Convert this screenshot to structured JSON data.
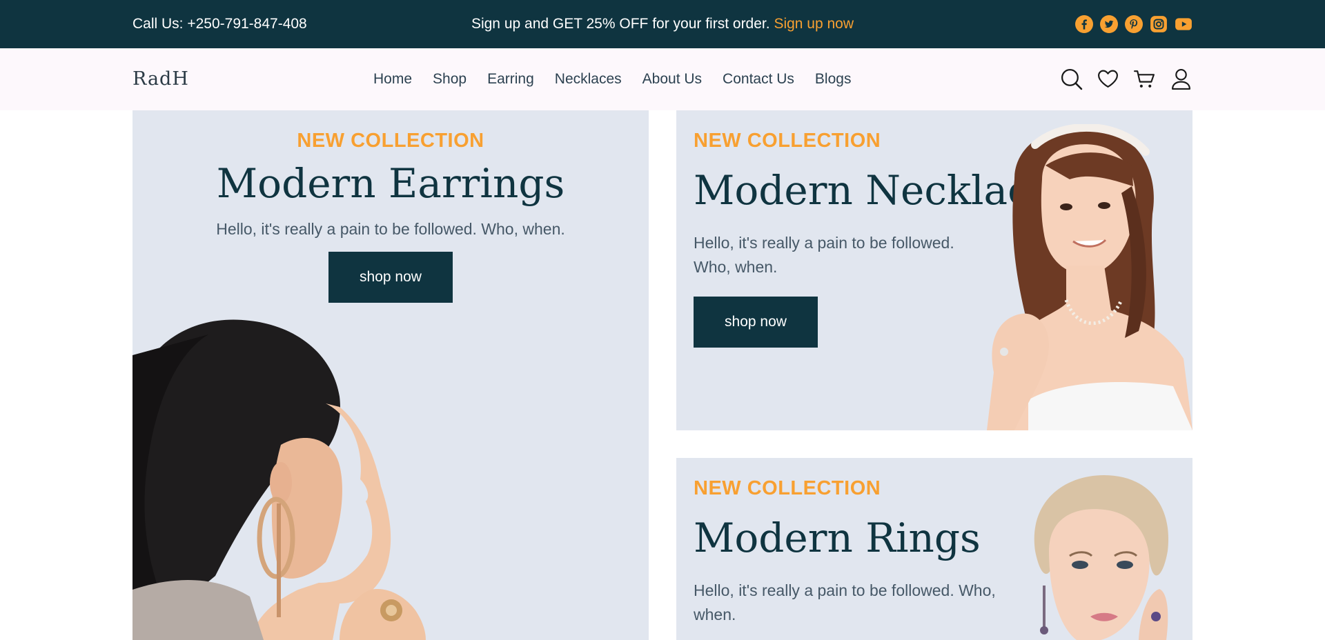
{
  "topbar": {
    "call": "Call Us: +250-791-847-408",
    "promo_text": "Sign up and GET 25% OFF for your first order.",
    "promo_link": "Sign up now",
    "social": [
      "facebook-icon",
      "twitter-icon",
      "pinterest-icon",
      "instagram-icon",
      "youtube-icon"
    ]
  },
  "nav": {
    "logo": "RadH",
    "items": [
      "Home",
      "Shop",
      "Earring",
      "Necklaces",
      "About Us",
      "Contact Us",
      "Blogs"
    ],
    "icons": [
      "search-icon",
      "heart-icon",
      "cart-icon",
      "user-icon"
    ]
  },
  "panels": [
    {
      "eyebrow": "NEW COLLECTION",
      "title": "Modern Earrings",
      "description": "Hello, it's really a pain to be followed. Who, when.",
      "button": "shop now"
    },
    {
      "eyebrow": "NEW COLLECTION",
      "title": "Modern Necklace",
      "description": "Hello, it's really a pain to be followed. Who, when.",
      "button": "shop now"
    },
    {
      "eyebrow": "NEW COLLECTION",
      "title": "Modern Rings",
      "description": "Hello, it's really a pain to be followed. Who, when."
    }
  ],
  "colors": {
    "brand_dark": "#0f3440",
    "accent": "#f8a031",
    "panel_bg": "#e1e6ef",
    "nav_bg": "#fdf8fc"
  }
}
